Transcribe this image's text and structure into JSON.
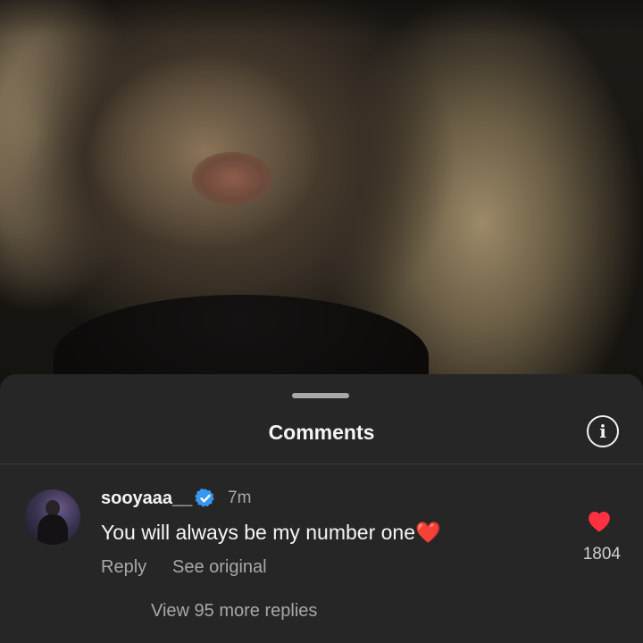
{
  "sheet": {
    "title": "Comments"
  },
  "comment": {
    "username": "sooyaaa__",
    "verified": true,
    "time": "7m",
    "text": "You will always be my number one",
    "emoji": "❤️",
    "reply_label": "Reply",
    "see_original_label": "See original",
    "like_count": "1804",
    "view_replies_label": "View 95 more replies"
  },
  "colors": {
    "sheet_bg": "#262626",
    "text_primary": "#f5f5f5",
    "text_secondary": "#a8a8a8",
    "like_red": "#ff3040",
    "verified_blue": "#3897f0"
  },
  "icons": {
    "info": "info-circle-icon",
    "verified": "verified-badge-icon",
    "like": "heart-filled-icon"
  }
}
